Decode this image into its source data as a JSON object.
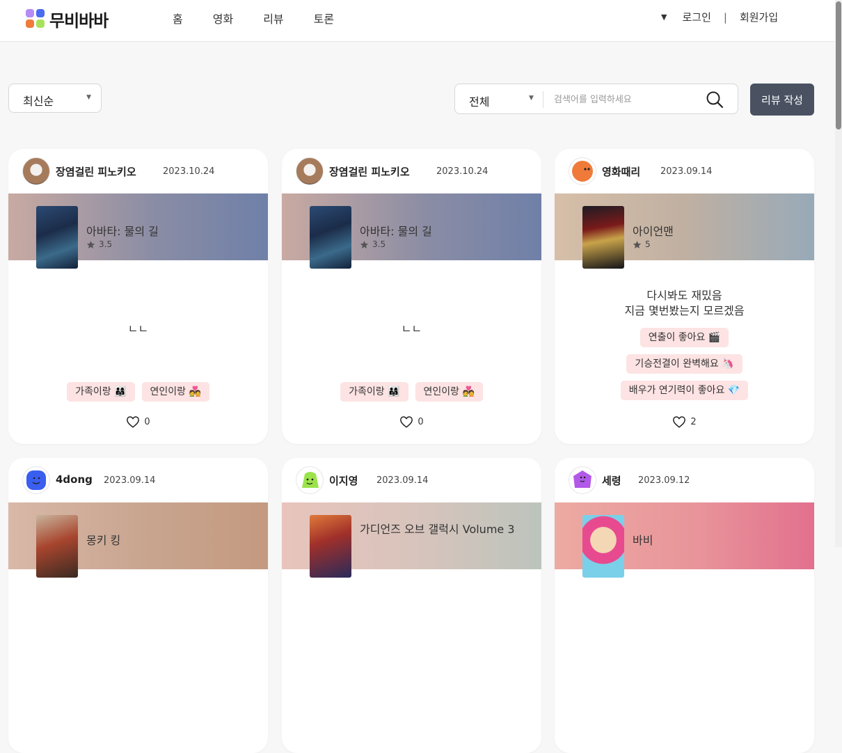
{
  "header": {
    "logo_text": "무비바바",
    "nav": [
      "홈",
      "영화",
      "리뷰",
      "토론"
    ],
    "login": "로그인",
    "separator": "|",
    "signup": "회원가입"
  },
  "filters": {
    "sort_value": "최신순",
    "category_value": "전체",
    "search_placeholder": "검색어를 입력하세요",
    "write_button": "리뷰 작성"
  },
  "reviews": [
    {
      "user": "장염걸린 피노키오",
      "date": "2023.10.24",
      "movie": "아바타: 물의 길",
      "rating": "3.5",
      "content": "ㄴㄴ",
      "tags": [
        "가족이랑 👨‍👩‍👧",
        "연인이랑 💑"
      ],
      "likes": "0"
    },
    {
      "user": "장염걸린 피노키오",
      "date": "2023.10.24",
      "movie": "아바타: 물의 길",
      "rating": "3.5",
      "content": "ㄴㄴ",
      "tags": [
        "가족이랑 👨‍👩‍👧",
        "연인이랑 💑"
      ],
      "likes": "0"
    },
    {
      "user": "영화때리",
      "date": "2023.09.14",
      "movie": "아이언맨",
      "rating": "5",
      "content": "다시봐도 재밌음\n지금 몇번봤는지 모르겠음",
      "tags": [
        "연출이 좋아요 🎬",
        "기승전결이 완벽해요 🦄",
        "배우가 연기력이 좋아요 💎"
      ],
      "likes": "2"
    },
    {
      "user": "4dong",
      "date": "2023.09.14",
      "movie": "몽키 킹"
    },
    {
      "user": "이지영",
      "date": "2023.09.14",
      "movie": "가디언즈 오브 갤럭시 Volume 3"
    },
    {
      "user": "세령",
      "date": "2023.09.12",
      "movie": "바비"
    }
  ],
  "colors": {
    "write_button_bg": "#4a5262",
    "tag_bg": "#fde3e3",
    "card_bg": "#ffffff"
  }
}
